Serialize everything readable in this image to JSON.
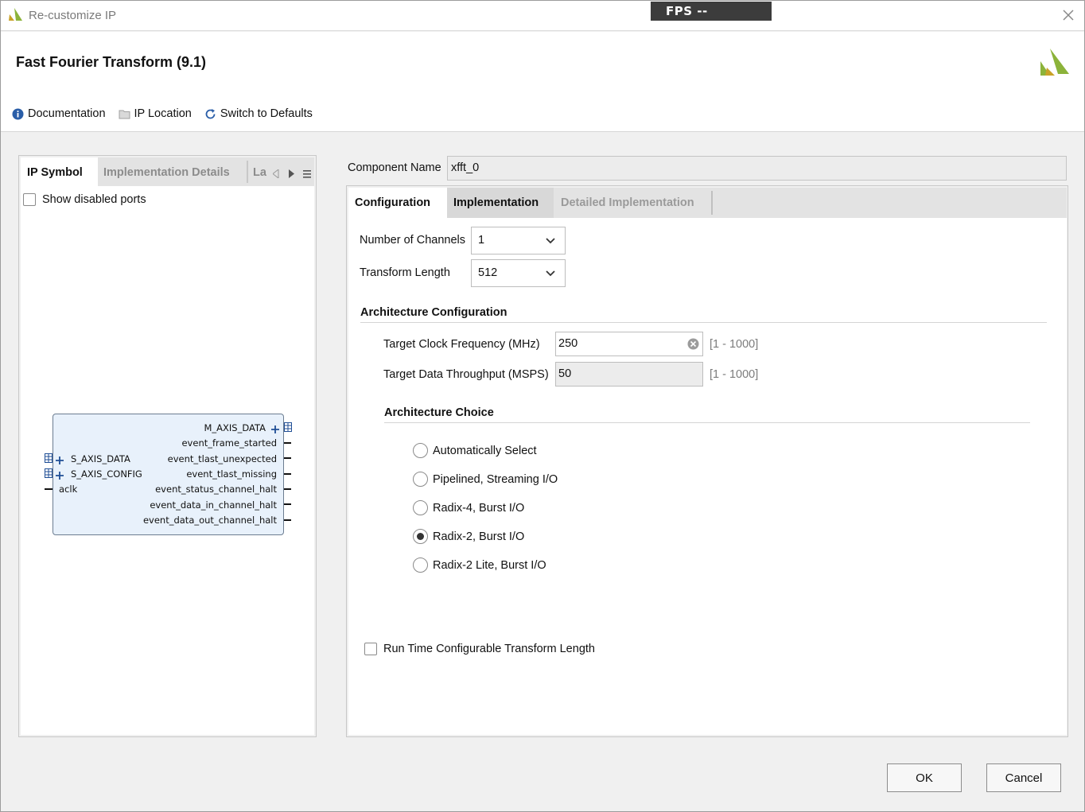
{
  "window": {
    "title": "Re-customize IP",
    "fps_label": "FPS --"
  },
  "header": {
    "title": "Fast Fourier Transform (9.1)"
  },
  "toolbar": {
    "documentation": "Documentation",
    "ip_location": "IP Location",
    "switch_defaults": "Switch to Defaults"
  },
  "left_panel": {
    "tabs": [
      "IP Symbol",
      "Implementation Details",
      "La"
    ],
    "show_disabled_ports": "Show disabled ports",
    "symbol": {
      "right_ports": [
        "M_AXIS_DATA",
        "event_frame_started",
        "event_tlast_unexpected",
        "event_tlast_missing",
        "event_status_channel_halt",
        "event_data_in_channel_halt",
        "event_data_out_channel_halt"
      ],
      "left_ports": [
        "S_AXIS_DATA",
        "S_AXIS_CONFIG",
        "aclk"
      ]
    }
  },
  "component": {
    "label": "Component Name",
    "value": "xfft_0"
  },
  "right_panel": {
    "tabs": [
      "Configuration",
      "Implementation",
      "Detailed Implementation"
    ],
    "num_channels": {
      "label": "Number of Channels",
      "value": "1"
    },
    "transform_length": {
      "label": "Transform Length",
      "value": "512"
    },
    "arch_config": {
      "title": "Architecture Configuration",
      "clock_freq": {
        "label": "Target Clock Frequency (MHz)",
        "value": "250",
        "range": "[1 - 1000]"
      },
      "throughput": {
        "label": "Target Data Throughput (MSPS)",
        "value": "50",
        "range": "[1 - 1000]"
      }
    },
    "arch_choice": {
      "title": "Architecture Choice",
      "options": [
        "Automatically Select",
        "Pipelined, Streaming I/O",
        "Radix-4, Burst I/O",
        "Radix-2, Burst I/O",
        "Radix-2 Lite, Burst I/O"
      ],
      "selected": "Radix-2, Burst I/O"
    },
    "runtime_config": "Run Time Configurable Transform Length"
  },
  "buttons": {
    "ok": "OK",
    "cancel": "Cancel"
  },
  "colors": {
    "accent_green": "#8cb33a",
    "info_blue": "#2a5ea8"
  }
}
